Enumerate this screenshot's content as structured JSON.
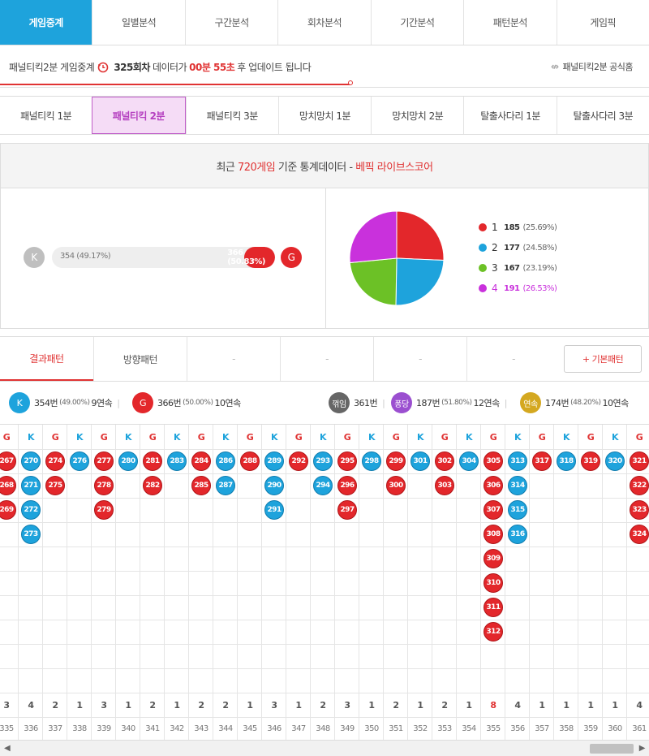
{
  "top_tabs": [
    "게임중계",
    "일별분석",
    "구간분석",
    "회차분석",
    "기간분석",
    "패턴분석",
    "게임픽"
  ],
  "status": {
    "prefix": "패널티킥2분 게임중계",
    "round": "325회차",
    "mid": "데이터가",
    "time": "00분 55초",
    "suffix": "후 업데이트 됩니다",
    "home": "패널티킥2분 공식홈",
    "progress": 0.54
  },
  "game_tabs": [
    "패널티킥 1분",
    "패널티킥 2분",
    "패널티킥 3분",
    "망치망치 1분",
    "망치망치 2분",
    "탈출사다리 1분",
    "탈출사다리 3분"
  ],
  "stats": {
    "hd_pre": "최근",
    "hd_games": "720게임",
    "hd_mid": "기준 통계데이터 -",
    "hd_brand": "베픽 라이브스코어",
    "k_letter": "K",
    "g_letter": "G",
    "k_text": "354 (49.17%)",
    "g_text": "366 (50.83%)",
    "g_fraction": 0.5083,
    "colors": {
      "k_gray": "#bfbfbf",
      "g_red": "#e3272b"
    }
  },
  "pie": [
    {
      "label": "1",
      "count": "185",
      "pct": "(25.69%)",
      "value": 185,
      "color": "#e3272b"
    },
    {
      "label": "2",
      "count": "177",
      "pct": "(24.58%)",
      "value": 177,
      "color": "#1ea3dc"
    },
    {
      "label": "3",
      "count": "167",
      "pct": "(23.19%)",
      "value": 167,
      "color": "#6cc126"
    },
    {
      "label": "4",
      "count": "191",
      "pct": "(26.53%)",
      "value": 191,
      "color": "#c931dc"
    }
  ],
  "result_tabs": [
    "결과패턴",
    "방향패턴",
    "-",
    "-",
    "-",
    "-"
  ],
  "basic_pattern": "+ 기본패턴",
  "summary": {
    "k": {
      "letter": "K",
      "count": "354번",
      "pct": "(49.00%)",
      "streak": "9연속",
      "color": "#1ea3dc"
    },
    "g": {
      "letter": "G",
      "count": "366번",
      "pct": "(50.00%)",
      "streak": "10연속",
      "color": "#e3272b"
    },
    "kkeok": {
      "label": "꺾임",
      "count": "361번",
      "color": "#666666"
    },
    "tong": {
      "label": "퐁당",
      "count": "187번",
      "pct": "(51.80%)",
      "streak": "12연속",
      "color": "#9b4fd0"
    },
    "yeon": {
      "label": "연속",
      "count": "174번",
      "pct": "(48.20%)",
      "streak": "10연속",
      "color": "#d4a820"
    }
  },
  "pattern_columns": [
    {
      "t": "G",
      "balls": [
        "267",
        "268",
        "269"
      ],
      "count": "3",
      "round": "335"
    },
    {
      "t": "K",
      "balls": [
        "270",
        "271",
        "272",
        "273"
      ],
      "count": "4",
      "round": "336"
    },
    {
      "t": "G",
      "balls": [
        "274",
        "275"
      ],
      "count": "2",
      "round": "337"
    },
    {
      "t": "K",
      "balls": [
        "276"
      ],
      "count": "1",
      "round": "338"
    },
    {
      "t": "G",
      "balls": [
        "277",
        "278",
        "279"
      ],
      "count": "3",
      "round": "339"
    },
    {
      "t": "K",
      "balls": [
        "280"
      ],
      "count": "1",
      "round": "340"
    },
    {
      "t": "G",
      "balls": [
        "281",
        "282"
      ],
      "count": "2",
      "round": "341"
    },
    {
      "t": "K",
      "balls": [
        "283"
      ],
      "count": "1",
      "round": "342"
    },
    {
      "t": "G",
      "balls": [
        "284",
        "285"
      ],
      "count": "2",
      "round": "343"
    },
    {
      "t": "K",
      "balls": [
        "286",
        "287"
      ],
      "count": "2",
      "round": "344"
    },
    {
      "t": "G",
      "balls": [
        "288"
      ],
      "count": "1",
      "round": "345"
    },
    {
      "t": "K",
      "balls": [
        "289",
        "290",
        "291"
      ],
      "count": "3",
      "round": "346"
    },
    {
      "t": "G",
      "balls": [
        "292"
      ],
      "count": "1",
      "round": "347"
    },
    {
      "t": "K",
      "balls": [
        "293",
        "294"
      ],
      "count": "2",
      "round": "348"
    },
    {
      "t": "G",
      "balls": [
        "295",
        "296",
        "297"
      ],
      "count": "3",
      "round": "349"
    },
    {
      "t": "K",
      "balls": [
        "298"
      ],
      "count": "1",
      "round": "350"
    },
    {
      "t": "G",
      "balls": [
        "299",
        "300"
      ],
      "count": "2",
      "round": "351"
    },
    {
      "t": "K",
      "balls": [
        "301"
      ],
      "count": "1",
      "round": "352"
    },
    {
      "t": "G",
      "balls": [
        "302",
        "303"
      ],
      "count": "2",
      "round": "353"
    },
    {
      "t": "K",
      "balls": [
        "304"
      ],
      "count": "1",
      "round": "354"
    },
    {
      "t": "G",
      "balls": [
        "305",
        "306",
        "307",
        "308",
        "309",
        "310",
        "311",
        "312"
      ],
      "count": "8",
      "round": "355"
    },
    {
      "t": "K",
      "balls": [
        "313",
        "314",
        "315",
        "316"
      ],
      "count": "4",
      "round": "356"
    },
    {
      "t": "G",
      "balls": [
        "317"
      ],
      "count": "1",
      "round": "357"
    },
    {
      "t": "K",
      "balls": [
        "318"
      ],
      "count": "1",
      "round": "358"
    },
    {
      "t": "G",
      "balls": [
        "319"
      ],
      "count": "1",
      "round": "359"
    },
    {
      "t": "K",
      "balls": [
        "320"
      ],
      "count": "1",
      "round": "360"
    },
    {
      "t": "G",
      "balls": [
        "321",
        "322",
        "323",
        "324"
      ],
      "count": "4",
      "round": "361"
    }
  ],
  "highlight_count": "8"
}
